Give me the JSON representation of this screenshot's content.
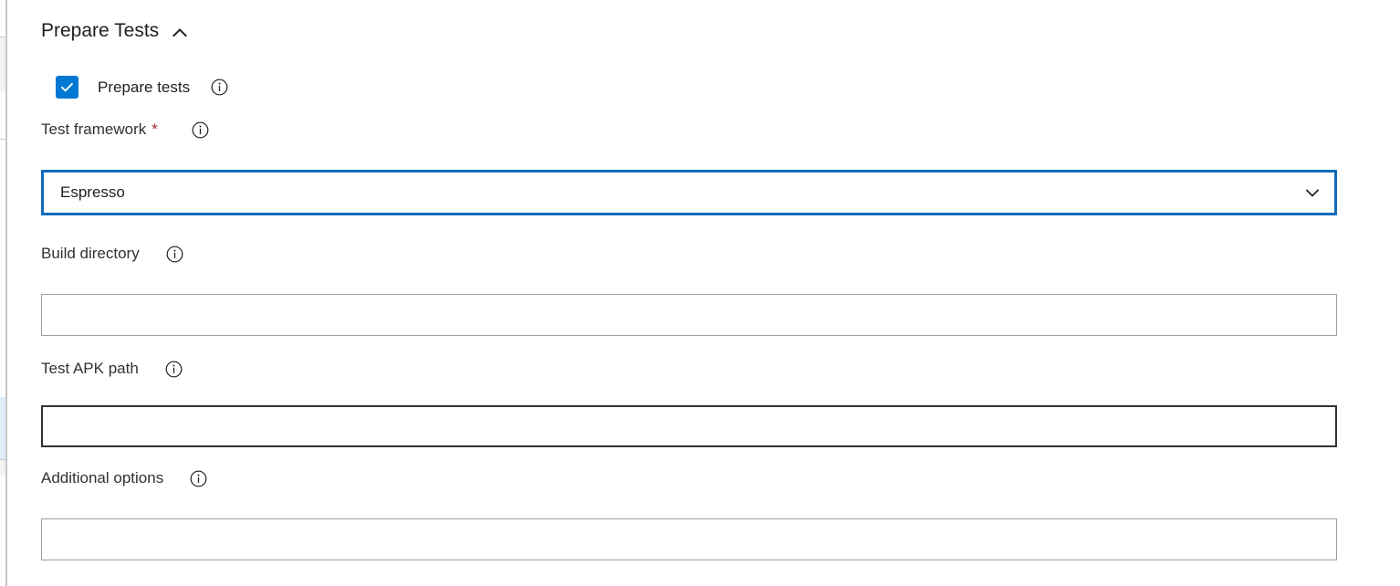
{
  "section": {
    "title": "Prepare Tests",
    "collapse_icon": "chevron-up-icon",
    "expanded": true
  },
  "checkbox": {
    "label": "Prepare tests",
    "checked": true,
    "check_icon": "checkmark-icon",
    "info_icon": "info-icon"
  },
  "fields": {
    "test_framework": {
      "label": "Test framework",
      "required_marker": "*",
      "info_icon": "info-icon",
      "control": "dropdown",
      "value": "Espresso",
      "placeholder": "",
      "dropdown_icon": "chevron-down-icon",
      "state": "focused"
    },
    "build_directory": {
      "label": "Build directory",
      "info_icon": "info-icon",
      "control": "text",
      "value": "",
      "placeholder": "",
      "state": "default"
    },
    "test_apk_path": {
      "label": "Test APK path",
      "info_icon": "info-icon",
      "control": "text",
      "value": "",
      "placeholder": "",
      "state": "hovered"
    },
    "additional_options": {
      "label": "Additional options",
      "info_icon": "info-icon",
      "control": "text",
      "value": "",
      "placeholder": "",
      "state": "default"
    }
  },
  "colors": {
    "accent": "#0078d4",
    "focus_border": "#0f6cbd",
    "required": "#a4262c",
    "input_border": "#a19f9d",
    "input_border_hover": "#323130",
    "text": "#201f1e",
    "selected_nav": "#deecf9",
    "divider": "#c8c6c4"
  }
}
